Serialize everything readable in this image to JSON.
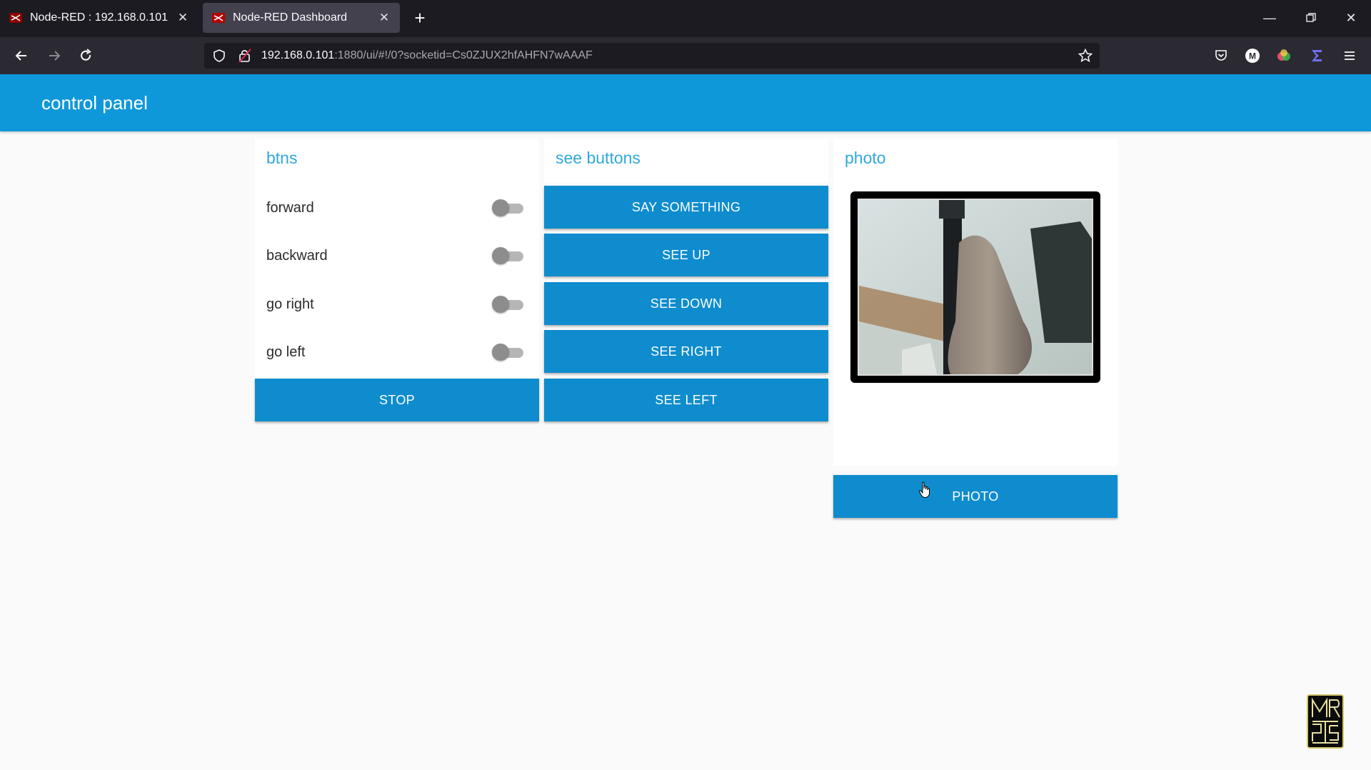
{
  "browser": {
    "tabs": [
      {
        "title": "Node-RED : 192.168.0.101",
        "active": false
      },
      {
        "title": "Node-RED Dashboard",
        "active": true
      }
    ],
    "url": {
      "host": "192.168.0.101",
      "rest": ":1880/ui/#!/0?socketid=Cs0ZJUX2hfAHFN7wAAAF"
    }
  },
  "dashboard": {
    "title": "control panel",
    "accent_color": "#0e98d9",
    "button_color": "#0f8ccd",
    "groups": {
      "btns": {
        "title": "btns",
        "switches": [
          {
            "label": "forward",
            "on": false
          },
          {
            "label": "backward",
            "on": false
          },
          {
            "label": "go right",
            "on": false
          },
          {
            "label": "go left",
            "on": false
          }
        ],
        "stop_label": "STOP"
      },
      "see": {
        "title": "see buttons",
        "buttons": [
          "SAY SOMETHING",
          "SEE UP",
          "SEE DOWN",
          "SEE RIGHT",
          "SEE LEFT"
        ]
      },
      "photo": {
        "title": "photo",
        "button_label": "PHOTO"
      }
    }
  }
}
